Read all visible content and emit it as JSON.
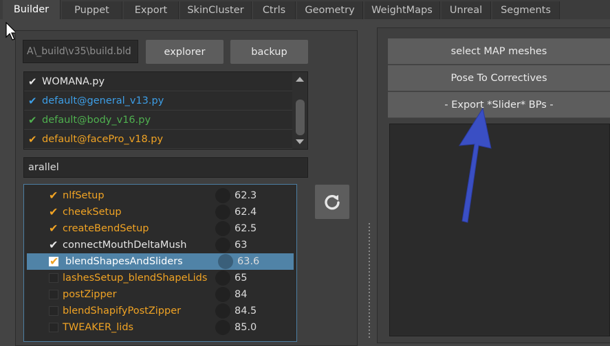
{
  "tabs": [
    "Builder",
    "Puppet",
    "Export",
    "SkinCluster",
    "Ctrls",
    "Geometry",
    "WeightMaps",
    "Unreal",
    "Segments"
  ],
  "active_tab": "Builder",
  "build_path": "A\\_build\\v35\\build.bld",
  "buttons": {
    "explorer": "explorer",
    "backup": "backup"
  },
  "files": [
    {
      "name": "WOMANA.py",
      "color": "#e6e6e6",
      "check_color": "#e6e6e6"
    },
    {
      "name": "default@general_v13.py",
      "color": "#3d9ee6",
      "check_color": "#3d9ee6"
    },
    {
      "name": "default@body_v16.py",
      "color": "#4fb04f",
      "check_color": "#4fb04f"
    },
    {
      "name": "default@facePro_v18.py",
      "color": "#f0a324",
      "check_color": "#f0a324"
    }
  ],
  "filter_text": "arallel",
  "steps": [
    {
      "label": "nlfSetup",
      "value": "62.3",
      "checked": true,
      "check_color": "#f0a324",
      "label_color": "#f0a324"
    },
    {
      "label": "cheekSetup",
      "value": "62.4",
      "checked": true,
      "check_color": "#f0a324",
      "label_color": "#f0a324"
    },
    {
      "label": "createBendSetup",
      "value": "62.5",
      "checked": true,
      "check_color": "#f0a324",
      "label_color": "#f0a324"
    },
    {
      "label": "connectMouthDeltaMush",
      "value": "63",
      "checked": true,
      "check_color": "#e6e6e6",
      "label_color": "#e6e6e6"
    },
    {
      "label": "blendShapesAndSliders",
      "value": "63.6",
      "checked": true,
      "check_color": "#f0a324",
      "label_color": "#ffffff",
      "selected": true
    },
    {
      "label": "lashesSetup_blendShapeLids",
      "value": "65",
      "checked": false,
      "label_color": "#f0a324"
    },
    {
      "label": "postZipper",
      "value": "84",
      "checked": false,
      "label_color": "#f0a324"
    },
    {
      "label": "blendShapifyPostZipper",
      "value": "84.5",
      "checked": false,
      "label_color": "#f0a324"
    },
    {
      "label": "TWEAKER_lids",
      "value": "85.0",
      "checked": false,
      "label_color": "#f0a324"
    }
  ],
  "right_buttons": [
    "select MAP meshes",
    "Pose To Correctives",
    "- Export *Slider* BPs -"
  ],
  "icons": {
    "refresh": "refresh-icon",
    "cursor": "mouse-cursor-icon",
    "annotation": "blue-arrow-annotation"
  },
  "colors": {
    "accent_orange": "#f0a324",
    "selection_blue": "#5083a7",
    "annotation_blue": "#3a4fc4"
  }
}
